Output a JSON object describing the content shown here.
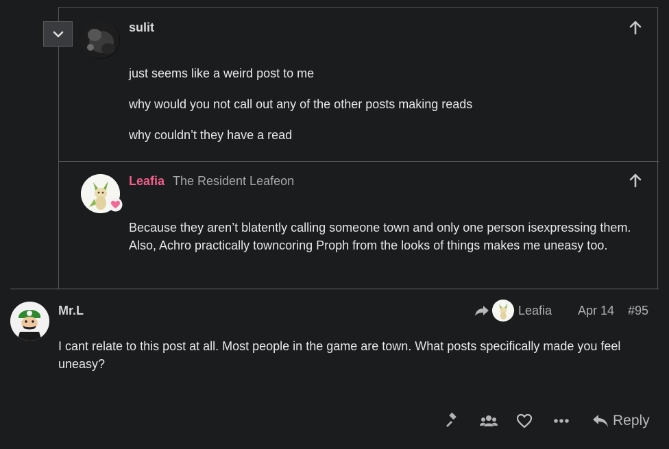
{
  "quote1": {
    "username": "sulit",
    "paragraphs": [
      "just seems like a weird post to me",
      "why would you not call out any of the other posts making reads",
      "why couldn’t they have a read"
    ]
  },
  "quote2": {
    "username": "Leafia",
    "title": "The Resident Leafeon",
    "body": "Because they aren’t blatently calling someone town and only one person isexpressing them. Also, Achro practically towncoring Proph from the looks of things makes me uneasy too."
  },
  "post": {
    "username": "Mr.L",
    "reply_to": "Leafia",
    "date": "Apr 14",
    "post_number": "#95",
    "body": "I cant relate to this post at all. Most people in the game are town. What posts specifically made you feel uneasy?"
  },
  "actions": {
    "reply_label": "Reply"
  },
  "colors": {
    "background": "#1b1c1e",
    "leafia_name": "#f0608a",
    "muted": "#a8a8a8"
  }
}
